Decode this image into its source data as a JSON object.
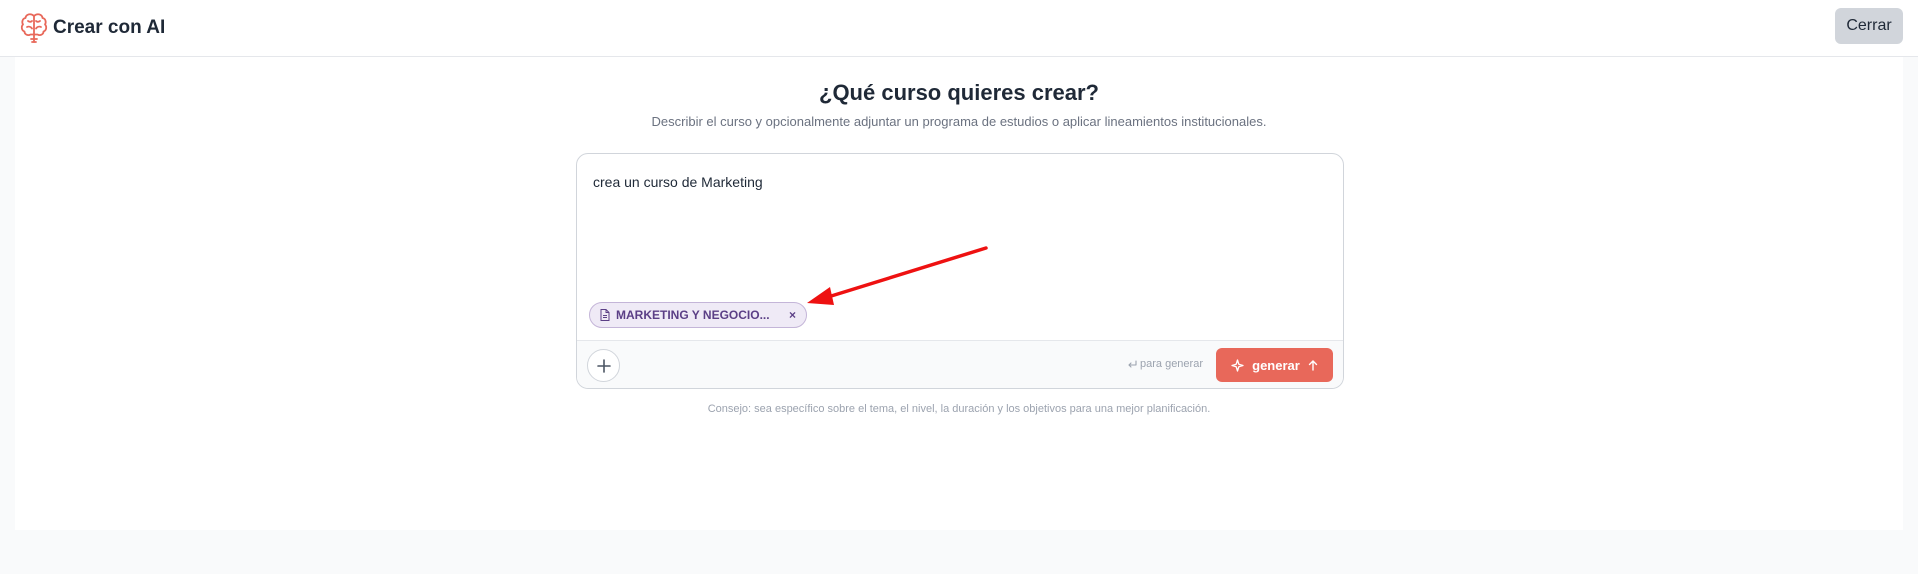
{
  "header": {
    "title": "Crear con AI",
    "brand_icon": "brain-icon",
    "close_label": "Cerrar"
  },
  "main": {
    "heading": "¿Qué curso quieres crear?",
    "subheading": "Describir el curso y opcionalmente adjuntar un programa de estudios o aplicar lineamientos institucionales.",
    "prompt_value": "crea un curso de Marketing",
    "attachment": {
      "label": "MARKETING Y NEGOCIO...",
      "icon": "document-icon",
      "remove": "×"
    },
    "hint": "para generar",
    "hint_icon": "enter-key-icon",
    "generate_label": "generar",
    "tip": "Consejo: sea específico sobre el tema, el nivel, la duración y los objetivos para una mejor planificación."
  },
  "colors": {
    "accent": "#e8685a",
    "chip_text": "#5b3f86",
    "chip_bg": "#efeaf6",
    "annotation_arrow": "#ee1111"
  }
}
